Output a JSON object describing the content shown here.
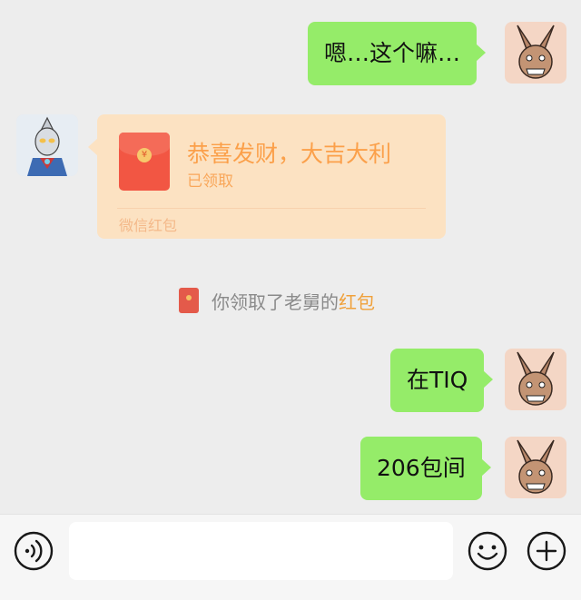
{
  "messages": [
    {
      "side": "right",
      "type": "text",
      "text": "嗯…这个嘛…"
    },
    {
      "side": "left",
      "type": "red_packet",
      "red_packet": {
        "title": "恭喜发财，大吉大利",
        "status": "已领取",
        "footer": "微信红包",
        "coin_symbol": "¥"
      }
    },
    {
      "type": "system_notice",
      "text": "你领取了老舅的",
      "link_text": "红包"
    },
    {
      "side": "right",
      "type": "text",
      "text": "在TIQ"
    },
    {
      "side": "right",
      "type": "text",
      "text": "206包间"
    }
  ],
  "input_bar": {
    "value": "",
    "left_icon": "voice-icon",
    "emoji_icon": "emoji-icon",
    "plus_icon": "plus-icon"
  },
  "colors": {
    "background": "#ededed",
    "bubble_green": "#95ec69",
    "red_packet_bg": "#fce2c2",
    "red_packet_accent": "#fba04a",
    "envelope_red": "#f25643",
    "notice_link": "#f0a13b"
  }
}
